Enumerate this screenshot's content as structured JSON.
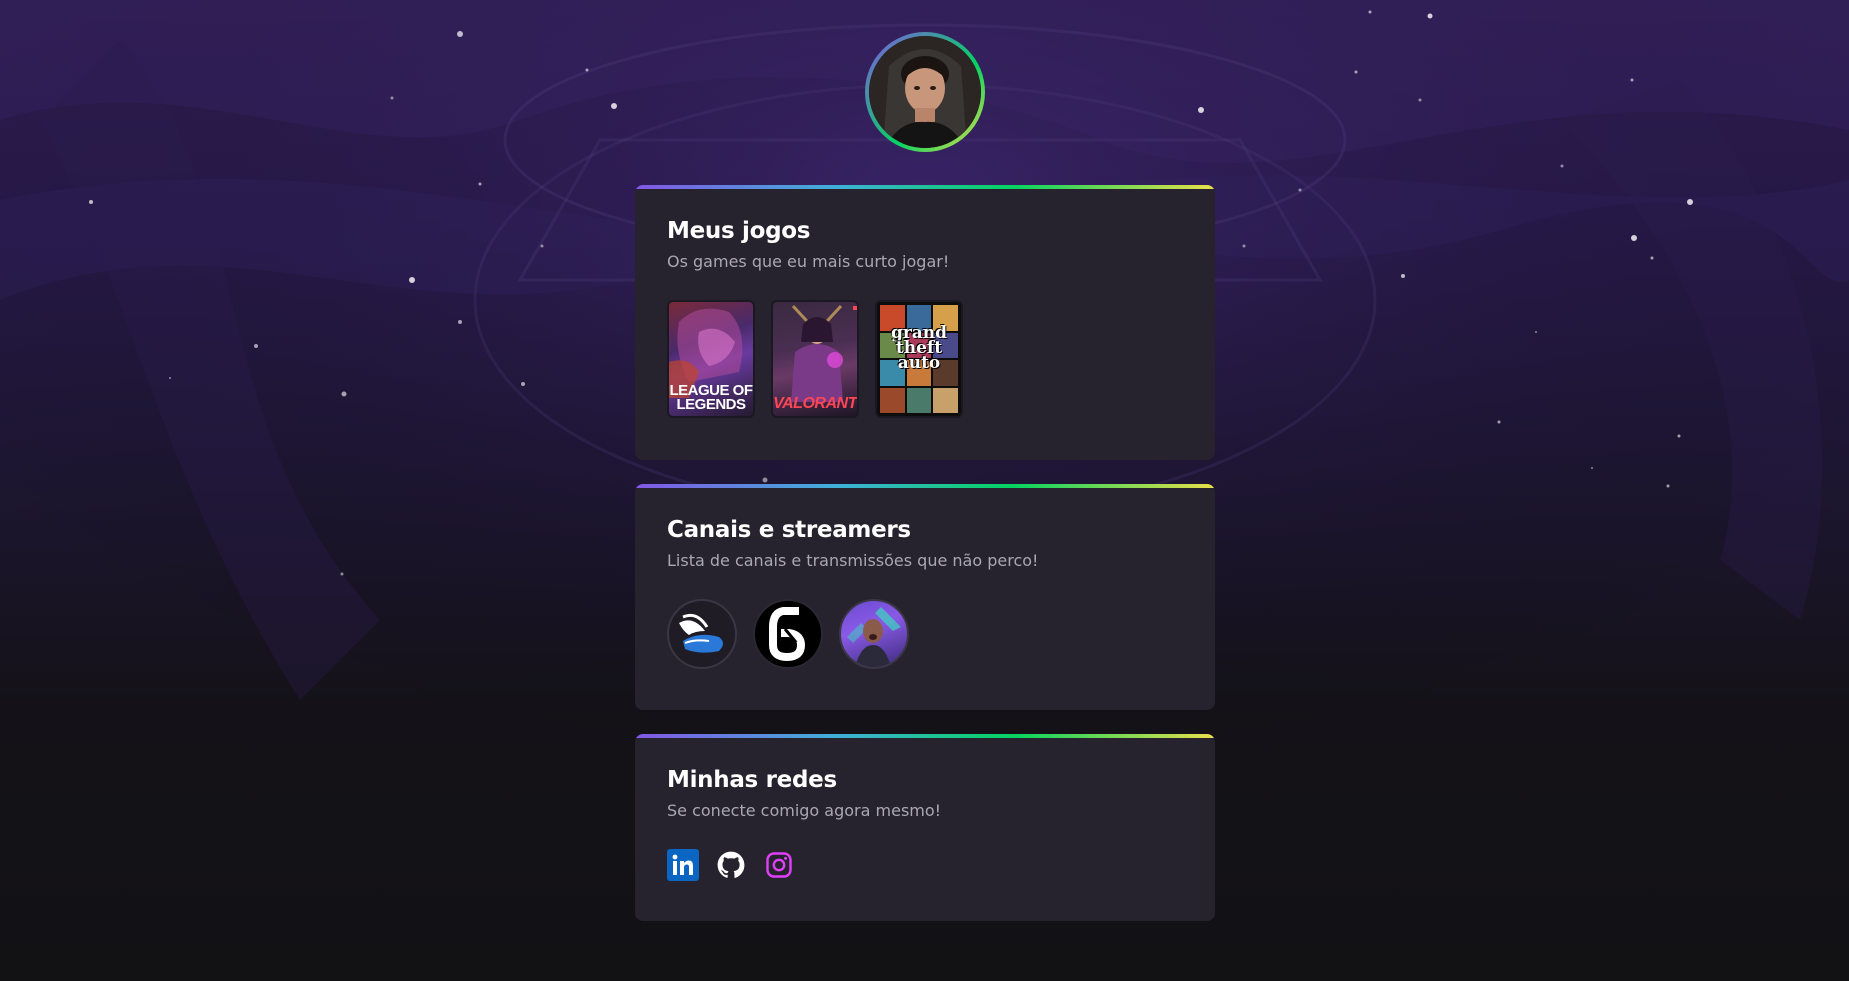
{
  "profile": {
    "avatar_icon": "profile-photo"
  },
  "cards": {
    "games": {
      "title": "Meus jogos",
      "subtitle": "Os games que eu mais curto jogar!",
      "items": [
        {
          "name": "League of Legends",
          "label_line1": "LEAGUE OF",
          "label_line2": "LEGENDS",
          "icon": "league-of-legends-cover"
        },
        {
          "name": "Valorant",
          "label": "VALORANT",
          "icon": "valorant-cover"
        },
        {
          "name": "Grand Theft Auto V",
          "label_line1": "grand",
          "label_line2": "theft",
          "label_line3": "auto",
          "icon": "gta-v-cover"
        }
      ]
    },
    "streamers": {
      "title": "Canais e streamers",
      "subtitle": "Lista de canais e transmissões que não perco!",
      "items": [
        {
          "icon": "winged-shoe-logo"
        },
        {
          "icon": "number-six-logo"
        },
        {
          "icon": "streamer-photo"
        }
      ]
    },
    "socials": {
      "title": "Minhas redes",
      "subtitle": "Se conecte comigo agora mesmo!",
      "items": [
        {
          "icon": "linkedin-icon",
          "color": "#0a66c2"
        },
        {
          "icon": "github-icon",
          "color": "#ffffff"
        },
        {
          "icon": "instagram-icon",
          "color": "#e040fb"
        }
      ]
    }
  },
  "colors": {
    "accent_gradient": [
      "#8257e6",
      "#04d361",
      "#eadf4a"
    ],
    "card_bg": "#26232e",
    "subtitle": "#a8a8b3"
  }
}
